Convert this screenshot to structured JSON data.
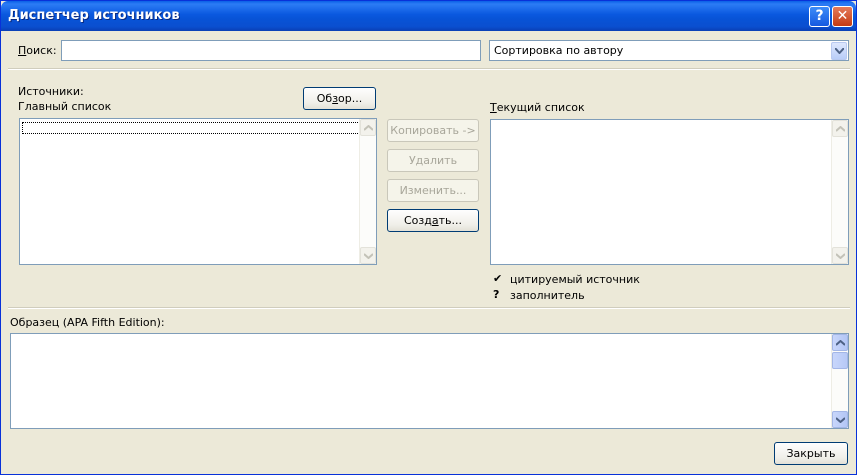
{
  "window": {
    "title": "Диспетчер источников",
    "help_label": "?",
    "close_label": "✕"
  },
  "search": {
    "label_prefix": "П",
    "label_rest": "оиск:",
    "value": ""
  },
  "sort": {
    "selected": "Сортировка по автору"
  },
  "sources": {
    "label": "Источники:",
    "master_list_label": "Главный список",
    "browse_prefix": "Об",
    "browse_access": "з",
    "browse_suffix": "ор...",
    "master_items": [],
    "current_label_prefix": "Т",
    "current_label_rest": "екущий список",
    "current_items": []
  },
  "actions": {
    "copy": "Копировать ->",
    "delete": "Удалить",
    "edit": "Изменить...",
    "create_prefix": "Созд",
    "create_access": "а",
    "create_suffix": "ть..."
  },
  "legend": {
    "cited_mark": "✔",
    "cited_text": "цитируемый источник",
    "placeholder_mark": "?",
    "placeholder_text": "заполнитель"
  },
  "preview": {
    "label": "Образец (APA Fifth Edition):",
    "content": ""
  },
  "footer": {
    "close_button": "Закрыть"
  }
}
